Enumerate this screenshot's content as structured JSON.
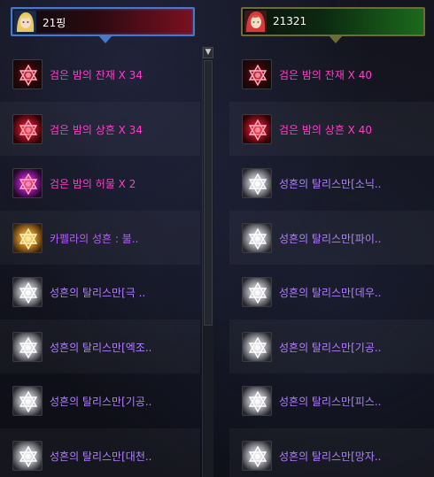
{
  "left": {
    "player_name": "21핑",
    "items": [
      {
        "name": "검은 밤의 잔재 X 34",
        "color": "pink",
        "icon": "dark-red-star-emblem-icon",
        "style": "dark-red"
      },
      {
        "name": "검은 밤의 상흔 X 34",
        "color": "pink",
        "icon": "red-star-emblem-icon",
        "style": "red-orb"
      },
      {
        "name": "검은 밤의 허물 X 2",
        "color": "pink",
        "icon": "purple-orb-emblem-icon",
        "style": "purple-orb"
      },
      {
        "name": "카펠라의 성흔 : 불..",
        "color": "purple",
        "icon": "gold-star-talisman-icon",
        "style": "gold"
      },
      {
        "name": "성흔의 탈리스만[극 ..",
        "color": "violet",
        "icon": "silver-star-talisman-icon",
        "style": "silver"
      },
      {
        "name": "성흔의 탈리스만[엑조..",
        "color": "violet",
        "icon": "silver-star-talisman-icon",
        "style": "silver"
      },
      {
        "name": "성흔의 탈리스만[기공..",
        "color": "violet",
        "icon": "silver-star-talisman-icon",
        "style": "silver"
      },
      {
        "name": "성흔의 탈리스만[대천..",
        "color": "violet",
        "icon": "silver-star-talisman-icon",
        "style": "silver"
      }
    ]
  },
  "right": {
    "player_name": "21321",
    "items": [
      {
        "name": "검은 밤의 잔재 X 40",
        "color": "pink",
        "icon": "dark-red-star-emblem-icon",
        "style": "dark-red"
      },
      {
        "name": "검은 밤의 상흔 X 40",
        "color": "pink",
        "icon": "red-star-emblem-icon",
        "style": "red-orb"
      },
      {
        "name": "성흔의 탈리스만[소닉..",
        "color": "violet",
        "icon": "silver-star-talisman-icon",
        "style": "silver"
      },
      {
        "name": "성흔의 탈리스만[파이..",
        "color": "violet",
        "icon": "silver-star-talisman-icon",
        "style": "silver"
      },
      {
        "name": "성흔의 탈리스만[데우..",
        "color": "violet",
        "icon": "silver-star-talisman-icon",
        "style": "silver"
      },
      {
        "name": "성흔의 탈리스만[기공..",
        "color": "violet",
        "icon": "silver-star-talisman-icon",
        "style": "silver"
      },
      {
        "name": "성흔의 탈리스만[피스..",
        "color": "violet",
        "icon": "silver-star-talisman-icon",
        "style": "silver"
      },
      {
        "name": "성흔의 탈리스만[망자..",
        "color": "violet",
        "icon": "silver-star-talisman-icon",
        "style": "silver"
      }
    ]
  },
  "colors": {
    "pink": "#ff3dc8",
    "purple": "#b45cff",
    "violet": "#b07fff",
    "left_border": "#4a78c8",
    "right_border": "#6f6a3a"
  }
}
